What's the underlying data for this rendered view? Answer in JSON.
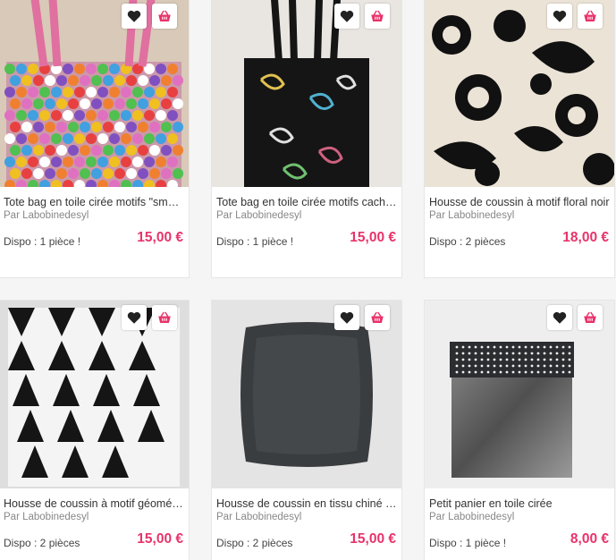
{
  "colors": {
    "price": "#e8336a",
    "cart_icon": "#e8336a",
    "heart_icon": "#222222"
  },
  "icons": {
    "favorite": "heart-icon",
    "cart": "basket-icon"
  },
  "products": [
    {
      "title": "Tote bag en toile cirée motifs \"smarties\"",
      "seller": "Par Labobinedesyl",
      "availability": "Dispo : 1 pièce !",
      "price": "15,00 €"
    },
    {
      "title": "Tote bag en toile cirée motifs cachemire",
      "seller": "Par Labobinedesyl",
      "availability": "Dispo : 1 pièce !",
      "price": "15,00 €"
    },
    {
      "title": "Housse de coussin à motif floral noir",
      "seller": "Par Labobinedesyl",
      "availability": "Dispo : 2 pièces",
      "price": "18,00 €"
    },
    {
      "title": "Housse de coussin à motif géométrique",
      "seller": "Par Labobinedesyl",
      "availability": "Dispo : 2 pièces",
      "price": "15,00 €"
    },
    {
      "title": "Housse de coussin en tissu chiné gris",
      "seller": "Par Labobinedesyl",
      "availability": "Dispo : 2 pièces",
      "price": "15,00 €"
    },
    {
      "title": "Petit panier en toile cirée",
      "seller": "Par Labobinedesyl",
      "availability": "Dispo : 1 pièce !",
      "price": "8,00 €"
    }
  ]
}
